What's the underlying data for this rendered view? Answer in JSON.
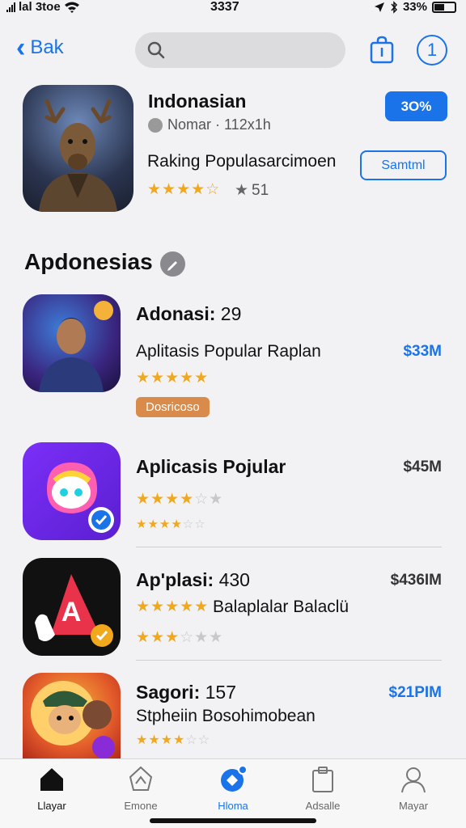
{
  "status": {
    "carrier": "lal 3toe",
    "time": "3337",
    "battery": "33%"
  },
  "nav": {
    "back_label": "Bak",
    "search_placeholder": ""
  },
  "featured": {
    "title": "Indonasian",
    "meta": "Nomar · 112x1h",
    "subtitle": "Raking Populasarcimoen",
    "stars": "★★★★☆",
    "rating_count": "51",
    "price_badge": "3O%",
    "action_button": "Samtml"
  },
  "section": {
    "title": "Apdonesias"
  },
  "apps": [
    {
      "name": "Adonasi:",
      "num": "29",
      "subtitle": "Aplitasis Popular Raplan",
      "price": "$33M",
      "price_color": "#1a73e8",
      "stars_full": "★★★★★",
      "stars_empty": "",
      "tag": "Dosricoso"
    },
    {
      "name": "Aplicasis Pojular",
      "num": "",
      "subtitle": "",
      "price": "$45M",
      "price_color": "#333333",
      "stars_full": "★★★★",
      "stars_empty": "☆★",
      "stars2_full": "★★★★",
      "stars2_empty": "☆☆"
    },
    {
      "name": "Apʹplasi:",
      "num": "430",
      "subtitle": "Balaplalar Balaclü",
      "price": "$436IM",
      "price_color": "#333333",
      "stars_full": "★★★★★",
      "stars_empty": "",
      "stars2_full": "★★★",
      "stars2_empty": "☆★★"
    },
    {
      "name": "Sagori:",
      "num": "157",
      "subtitle": "Stpheiin Bosohimobean",
      "price": "$21PIM",
      "price_color": "#1a73e8",
      "stars_full": "★★★★",
      "stars_empty": "☆☆"
    }
  ],
  "tabs": [
    {
      "label": "Llayar"
    },
    {
      "label": "Emone"
    },
    {
      "label": "Hloma"
    },
    {
      "label": "Adsalle"
    },
    {
      "label": "Mayar"
    }
  ]
}
